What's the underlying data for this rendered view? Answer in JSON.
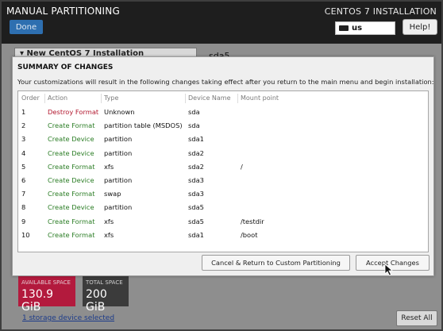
{
  "header": {
    "title": "MANUAL PARTITIONING",
    "done_label": "Done",
    "install_title": "CENTOS 7 INSTALLATION",
    "keyboard_layout": "us",
    "help_label": "Help!"
  },
  "background": {
    "expander_label": "▾ New CentOS 7 Installation",
    "selected_device": "sda5",
    "available_space_label": "AVAILABLE SPACE",
    "available_space_value": "130.9 GiB",
    "total_space_label": "TOTAL SPACE",
    "total_space_value": "200 GiB",
    "storage_link": "1 storage device selected",
    "reset_label": "Reset All"
  },
  "dialog": {
    "title": "SUMMARY OF CHANGES",
    "description": "Your customizations will result in the following changes taking effect after you return to the main menu and begin installation:",
    "columns": [
      "Order",
      "Action",
      "Type",
      "Device Name",
      "Mount point"
    ],
    "rows": [
      {
        "order": "1",
        "action": "Destroy Format",
        "type": "Unknown",
        "device": "sda",
        "mount": ""
      },
      {
        "order": "2",
        "action": "Create Format",
        "type": "partition table (MSDOS)",
        "device": "sda",
        "mount": ""
      },
      {
        "order": "3",
        "action": "Create Device",
        "type": "partition",
        "device": "sda1",
        "mount": ""
      },
      {
        "order": "4",
        "action": "Create Device",
        "type": "partition",
        "device": "sda2",
        "mount": ""
      },
      {
        "order": "5",
        "action": "Create Format",
        "type": "xfs",
        "device": "sda2",
        "mount": "/"
      },
      {
        "order": "6",
        "action": "Create Device",
        "type": "partition",
        "device": "sda3",
        "mount": ""
      },
      {
        "order": "7",
        "action": "Create Format",
        "type": "swap",
        "device": "sda3",
        "mount": ""
      },
      {
        "order": "8",
        "action": "Create Device",
        "type": "partition",
        "device": "sda5",
        "mount": ""
      },
      {
        "order": "9",
        "action": "Create Format",
        "type": "xfs",
        "device": "sda5",
        "mount": "/testdir"
      },
      {
        "order": "10",
        "action": "Create Format",
        "type": "xfs",
        "device": "sda1",
        "mount": "/boot"
      }
    ],
    "cancel_label": "Cancel & Return to Custom Partitioning",
    "accept_label": "Accept Changes"
  },
  "colors": {
    "destroy": "#b2172e",
    "create": "#2b7d25",
    "accent_blue": "#2e6fb0",
    "available_space": "#b31a3d"
  },
  "icons": {
    "keyboard": "keyboard-icon",
    "cursor": "mouse-pointer-icon"
  }
}
